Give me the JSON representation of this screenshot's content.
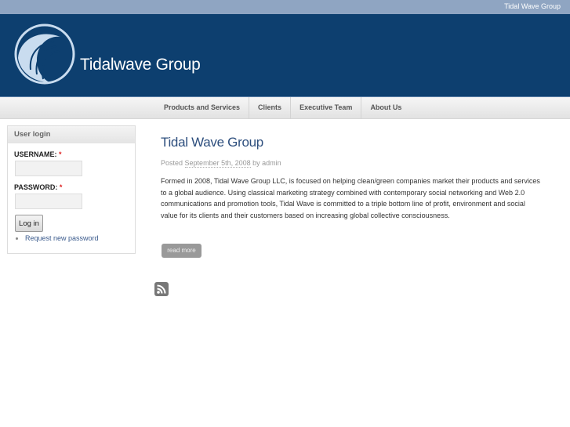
{
  "topbar": {
    "site_link": "Tidal Wave Group"
  },
  "header": {
    "site_name": "Tidalwave Group"
  },
  "nav": {
    "items": [
      "Products and Services",
      "Clients",
      "Executive Team",
      "About Us"
    ]
  },
  "login": {
    "title": "User login",
    "username_label": "USERNAME:",
    "password_label": "PASSWORD:",
    "required": "*",
    "submit": "Log in",
    "request_password": "Request new password",
    "username_value": "",
    "password_value": ""
  },
  "post": {
    "title": "Tidal Wave Group",
    "posted": "Posted",
    "date": "September 5th, 2008",
    "by": "by admin",
    "lines": [
      "Formed in 2008, Tidal Wave Group LLC, is focused on helping clean/green companies market their products and services",
      "to a global audience. Using classical marketing strategy combined with contemporary social networking and Web 2.0",
      "communications and promotion tools, Tidal Wave is committed to a triple bottom line of profit, environment and social",
      "value for its clients and their customers based on increasing global collective consciousness."
    ],
    "read_more": "read more"
  },
  "icons": {
    "rss": "rss-feed-icon",
    "logo": "wave-logo-icon"
  },
  "colors": {
    "header": "#0d3f6f",
    "topbar": "#8fa5c2",
    "link": "#3a5a8c"
  }
}
